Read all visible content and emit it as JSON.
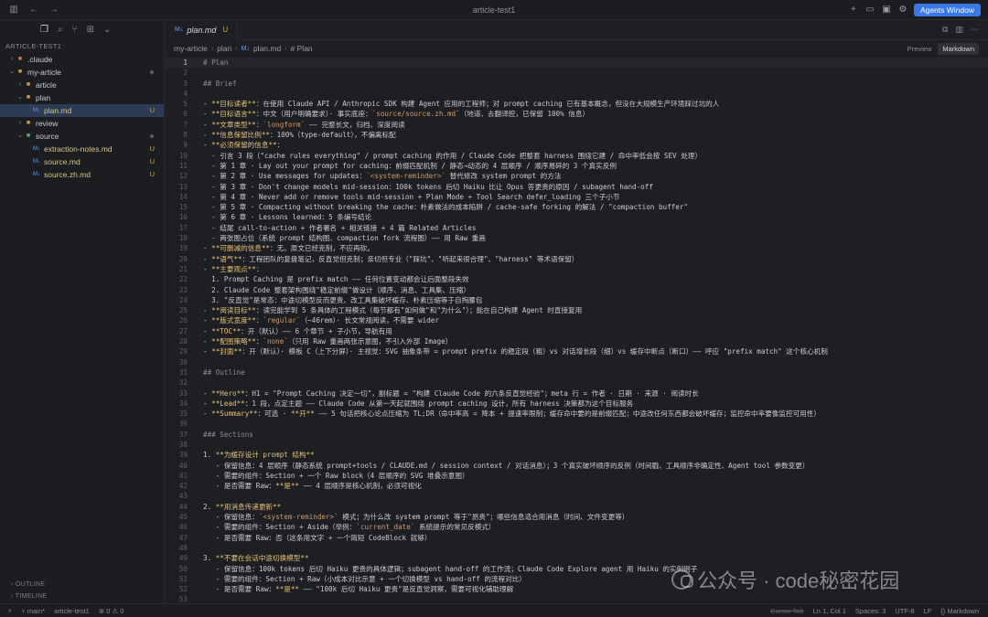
{
  "window": {
    "title": "article-test1",
    "agents_button": "Agents Window"
  },
  "sidebar": {
    "root": "ARTICLE-TEST1",
    "items": [
      {
        "label": ".claude",
        "kind": "folder",
        "depth": 1,
        "expanded": false,
        "status": ""
      },
      {
        "label": "my-article",
        "kind": "folder",
        "depth": 1,
        "expanded": true,
        "status": "dot"
      },
      {
        "label": "article",
        "kind": "folder",
        "depth": 2,
        "expanded": false,
        "status": ""
      },
      {
        "label": "plan",
        "kind": "folder",
        "depth": 2,
        "expanded": true,
        "status": ""
      },
      {
        "label": "plan.md",
        "kind": "md",
        "depth": 3,
        "expanded": false,
        "status": "U",
        "selected": true
      },
      {
        "label": "review",
        "kind": "folder",
        "depth": 2,
        "expanded": false,
        "status": ""
      },
      {
        "label": "source",
        "kind": "folder",
        "depth": 2,
        "expanded": true,
        "status": "dot"
      },
      {
        "label": "extraction-notes.md",
        "kind": "md",
        "depth": 3,
        "expanded": false,
        "status": "U"
      },
      {
        "label": "source.md",
        "kind": "md",
        "depth": 3,
        "expanded": false,
        "status": "U"
      },
      {
        "label": "source.zh.md",
        "kind": "md",
        "depth": 3,
        "expanded": false,
        "status": "U"
      }
    ],
    "outline": "OUTLINE",
    "timeline": "TIMELINE"
  },
  "tab": {
    "label": "plan.md",
    "badge": "U",
    "md_marker": "M↓"
  },
  "breadcrumb": [
    "my-article",
    "plan",
    "plan.md",
    "# Plan"
  ],
  "view": {
    "preview": "Preview",
    "markdown": "Markdown"
  },
  "code_lines": [
    [
      [
        "h",
        "# Plan"
      ]
    ],
    [],
    [
      [
        "h",
        "## Brief"
      ]
    ],
    [],
    [
      [
        "t",
        "- "
      ],
      [
        "b",
        "**目标读者**"
      ],
      [
        "t",
        "：在使用 Claude API / Anthropic SDK 构建 Agent 应用的工程师；对 prompt caching 已有基本概念，但没在大规模生产环境踩过坑的人"
      ]
    ],
    [
      [
        "t",
        "- "
      ],
      [
        "b",
        "**目标语言**"
      ],
      [
        "t",
        "：中文（用户明确要求）· 事实底座："
      ],
      [
        "c",
        "`source/source.zh.md`"
      ],
      [
        "t",
        "（地道、去翻译腔，已保留 100% 信息）"
      ]
    ],
    [
      [
        "t",
        "- "
      ],
      [
        "b",
        "**文章类型**"
      ],
      [
        "t",
        "："
      ],
      [
        "c",
        "`longform`"
      ],
      [
        "t",
        " —— 完整长文，归档、深度阅读"
      ]
    ],
    [
      [
        "t",
        "- "
      ],
      [
        "b",
        "**信息保留比例**"
      ],
      [
        "t",
        "：100%（type-default），不偏离标配"
      ]
    ],
    [
      [
        "t",
        "- "
      ],
      [
        "b",
        "**必须保留的信息**"
      ],
      [
        "t",
        "："
      ]
    ],
    [
      [
        "t",
        "  - 引言 3 段（\"cache rules everything\" / prompt caching 的作用 / Claude Code 把整套 harness 围绕它建 / 命中率低会按 SEV 处理）"
      ]
    ],
    [
      [
        "t",
        "  - 第 1 章 · Lay out your prompt for caching：前缀匹配机制 / 静态→动态的 4 层顺序 / 顺序易碎的 3 个真实反例"
      ]
    ],
    [
      [
        "t",
        "  - 第 2 章 · Use messages for updates："
      ],
      [
        "c",
        "`<system-reminder>`"
      ],
      [
        "t",
        " 替代修改 system prompt 的方法"
      ]
    ],
    [
      [
        "t",
        "  - 第 3 章 · Don't change models mid-session：100k tokens 后切 Haiku 比让 Opus 答更贵的原因 / subagent hand-off"
      ]
    ],
    [
      [
        "t",
        "  - 第 4 章 · Never add or remove tools mid-session + Plan Mode + Tool Search defer_loading 三个子小节"
      ]
    ],
    [
      [
        "t",
        "  - 第 5 章 · Compacting without breaking the cache：朴素做法的成本陷阱 / cache-safe forking 的解法 / \"compaction buffer\""
      ]
    ],
    [
      [
        "t",
        "  - 第 6 章 · Lessons learned：5 条编号结论"
      ]
    ],
    [
      [
        "t",
        "  - 结尾 call-to-action + 作者署名 + 相关链接 + 4 篇 Related Articles"
      ]
    ],
    [
      [
        "t",
        "  - 两张图占位（系统 prompt 结构图、compaction fork 流程图）—— 用 Raw 重画"
      ]
    ],
    [
      [
        "t",
        "- "
      ],
      [
        "b",
        "**可删减的信息**"
      ],
      [
        "t",
        "：无。原文已经克制，不应再砍。"
      ]
    ],
    [
      [
        "t",
        "- "
      ],
      [
        "b",
        "**语气**"
      ],
      [
        "t",
        "：工程团队的复盘笔记，反直觉但克制；亲切但专业（\"踩坑\"、\"听起来很合理\"、\"harness\" 等术语保留）"
      ]
    ],
    [
      [
        "t",
        "- "
      ],
      [
        "b",
        "**主要观点**"
      ],
      [
        "t",
        "："
      ]
    ],
    [
      [
        "t",
        "  1. Prompt Caching 是 prefix match —— 任何位置变动都会让后面整段失效"
      ]
    ],
    [
      [
        "t",
        "  2. Claude Code 整套架构围绕\"稳定前缀\"做设计（顺序、消息、工具集、压缩）"
      ]
    ],
    [
      [
        "t",
        "  3. \"反直觉\"是常态：中途切模型反而更贵、改工具集破坏缓存、朴素压缩等于自掏腰包"
      ]
    ],
    [
      [
        "t",
        "- "
      ],
      [
        "b",
        "**阅读目标**"
      ],
      [
        "t",
        "：读完能学到 5 条具体的工程模式（每节都有\"如何做\"和\"为什么\"）；能在自己构建 Agent 时直接复用"
      ]
    ],
    [
      [
        "t",
        "- "
      ],
      [
        "b",
        "**版式宽度**"
      ],
      [
        "t",
        "："
      ],
      [
        "c",
        "`regular`"
      ],
      [
        "t",
        "（~46rem）· 长文常规阅读，不需要 wider"
      ]
    ],
    [
      [
        "t",
        "- "
      ],
      [
        "b",
        "**TOC**"
      ],
      [
        "t",
        "：开（默认）—— 6 个章节 + 子小节，导航有用"
      ]
    ],
    [
      [
        "t",
        "- "
      ],
      [
        "b",
        "**配图策略**"
      ],
      [
        "t",
        "："
      ],
      [
        "c",
        "`none`"
      ],
      [
        "t",
        "（只用 Raw 重画两张示意图，不引入外部 Image）"
      ]
    ],
    [
      [
        "t",
        "- "
      ],
      [
        "b",
        "**封面**"
      ],
      [
        "t",
        "：开（默认）· 模板 C（上下分屏）· 主视觉：SVG 抽象条带 = prompt prefix 的稳定段（粗）vs 对话增长段（细）vs 缓存中断点（断口）—— 呼应 \"prefix match\" 这个核心机制"
      ]
    ],
    [],
    [
      [
        "h",
        "## Outline"
      ]
    ],
    [],
    [
      [
        "t",
        "- "
      ],
      [
        "b",
        "**Hero**"
      ],
      [
        "t",
        "：H1 = \"Prompt Caching 决定一切\"，副标题 = \"构建 Claude Code 的六条反直觉经验\"；meta 行 = 作者 · 日期 · 来源 · 阅读时长"
      ]
    ],
    [
      [
        "t",
        "- "
      ],
      [
        "b",
        "**Lead**"
      ],
      [
        "t",
        "：1 段，点定主题 —— Claude Code 从第一天起就围绕 prompt caching 设计，所有 harness 决策都为这个目标服务"
      ]
    ],
    [
      [
        "t",
        "- "
      ],
      [
        "b",
        "**Summary**"
      ],
      [
        "t",
        "：可选 · "
      ],
      [
        "b",
        "**开**"
      ],
      [
        "t",
        " —— 5 句话把核心论点压缩为 TL;DR（命中率高 = 降本 + 提速率限制；缓存命中要的是前缀匹配；中途改任何东西都会破坏缓存；监控命中率要像监控可用性）"
      ]
    ],
    [],
    [
      [
        "h",
        "### Sections"
      ]
    ],
    [],
    [
      [
        "t",
        "1. "
      ],
      [
        "b",
        "**为缓存设计 prompt 结构**"
      ]
    ],
    [
      [
        "t",
        "   - 保留信息：4 层顺序（静态系统 prompt+tools / CLAUDE.md / session context / 对话消息）；3 个真实破坏顺序的反例（时间戳、工具顺序非确定性、Agent tool 参数变更）"
      ]
    ],
    [
      [
        "t",
        "   - 需要的组件：Section + 一个 Raw block（4 层顺序的 SVG 堆叠示意图）"
      ]
    ],
    [
      [
        "t",
        "   - 是否需要 Raw："
      ],
      [
        "b",
        "**是**"
      ],
      [
        "t",
        " —— 4 层顺序是核心机制，必须可视化"
      ]
    ],
    [],
    [
      [
        "t",
        "2. "
      ],
      [
        "b",
        "**用消息传递更新**"
      ]
    ],
    [
      [
        "t",
        "   - 保留信息："
      ],
      [
        "c",
        "`<system-reminder>`"
      ],
      [
        "t",
        " 模式；为什么改 system prompt 等于\"昂贵\"；哪些信息适合用消息（时间、文件变更等）"
      ]
    ],
    [
      [
        "t",
        "   - 需要的组件：Section + Aside（举例："
      ],
      [
        "c",
        "`current_date`"
      ],
      [
        "t",
        " 系统提示的常见反模式）"
      ]
    ],
    [
      [
        "t",
        "   - 是否需要 Raw：否（这条用文字 + 一个简短 CodeBlock 就够）"
      ]
    ],
    [],
    [
      [
        "t",
        "3. "
      ],
      [
        "b",
        "**不要在会话中途切换模型**"
      ]
    ],
    [
      [
        "t",
        "   - 保留信息：100k tokens 后切 Haiku 更贵的具体逻辑；subagent hand-off 的工作流；Claude Code Explore agent 用 Haiku 的实例例子"
      ]
    ],
    [
      [
        "t",
        "   - 需要的组件：Section + Raw（小成本对比示意 + 一个切换模型 vs hand-off 的流程对比）"
      ]
    ],
    [
      [
        "t",
        "   - 是否需要 Raw："
      ],
      [
        "b",
        "**是**"
      ],
      [
        "t",
        " —— \"100k 后切 Haiku 更贵\"是反直觉洞察，需要可视化辅助理解"
      ]
    ],
    []
  ],
  "status": {
    "branch": "main*",
    "workspace": "article-test1",
    "problems": "0",
    "warnings": "0",
    "cursor_tab": "Cursor Tab",
    "position": "Ln 1, Col 1",
    "spaces": "Spaces: 3",
    "encoding": "UTF-8",
    "eol": "LF",
    "language": "Markdown"
  },
  "watermark": "公众号 · code秘密花园",
  "icons": [
    "sidebar-toggle-icon",
    "back-icon",
    "forward-icon",
    "files-icon",
    "search-icon",
    "git-icon",
    "extensions-icon",
    "split-editor-icon",
    "settings-icon"
  ]
}
